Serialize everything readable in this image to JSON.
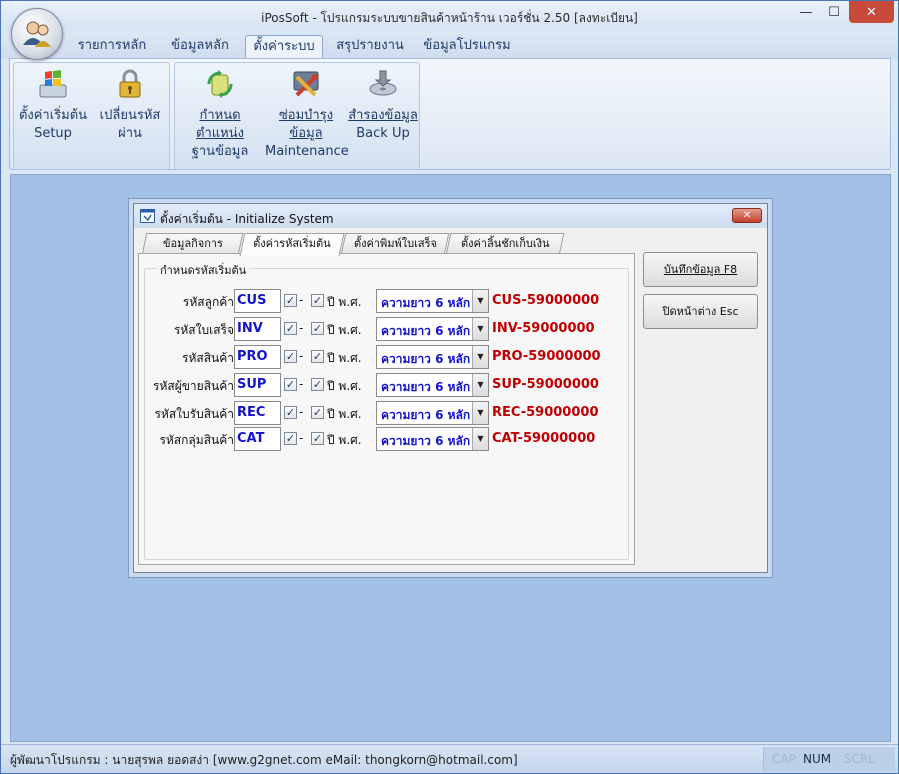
{
  "window": {
    "title": "iPosSoft - โปรแกรมระบบขายสินค้าหน้าร้าน เวอร์ชั่น 2.50 [ลงทะเบียน]",
    "min_glyph": "—",
    "max_glyph": "☐",
    "close_glyph": "✕"
  },
  "ribbon": {
    "tabs": [
      {
        "label": "รายการหลัก"
      },
      {
        "label": "ข้อมูลหลัก"
      },
      {
        "label": "ตั้งค่าระบบ"
      },
      {
        "label": "สรุปรายงาน"
      },
      {
        "label": "ข้อมูลโปรแกรม"
      }
    ],
    "active_tab": "ตั้งค่าระบบ",
    "buttons": [
      {
        "line1": "ตั้งค่าเริ่มต้น",
        "line2": "Setup",
        "icon": "windows-setup-icon"
      },
      {
        "line1": "เปลี่ยนรหัสผ่าน",
        "line2": "",
        "icon": "padlock-icon"
      },
      {
        "line1": "กำหนดตำแหน่ง",
        "line2": "ฐานข้อมูล",
        "icon": "database-location-icon"
      },
      {
        "line1": "ซ่อมบำรุงข้อมูล",
        "line2": "Maintenance",
        "icon": "tools-icon"
      },
      {
        "line1": "สำรองข้อมูล",
        "line2": "Back Up",
        "icon": "backup-disk-icon"
      }
    ]
  },
  "dialog": {
    "title": "ตั้งค่าเริ่มต้น - Initialize System",
    "close_glyph": "✕",
    "tabs": [
      {
        "label": "ข้อมูลกิจการ"
      },
      {
        "label": "ตั้งค่ารหัสเริ่มต้น"
      },
      {
        "label": "ตั้งค่าพิมพ์ใบเสร็จ"
      },
      {
        "label": "ตั้งค่าลิ้นชักเก็บเงิน"
      }
    ],
    "active_tab": "ตั้งค่ารหัสเริ่มต้น",
    "group_title": "กำหนดรหัสเริ่มต้น",
    "dash": "-",
    "check_glyph": "✓",
    "combo_arrow": "▼",
    "rows": [
      {
        "label": "รหัสลูกค้า",
        "code": "CUS",
        "use_dash": true,
        "use_year": true,
        "year_label": "ปี พ.ศ.",
        "length": "ความยาว 6 หลัก",
        "sample": "CUS-59000000"
      },
      {
        "label": "รหัสใบเสร็จ",
        "code": "INV",
        "use_dash": true,
        "use_year": true,
        "year_label": "ปี พ.ศ.",
        "length": "ความยาว 6 หลัก",
        "sample": "INV-59000000"
      },
      {
        "label": "รหัสสินค้า",
        "code": "PRO",
        "use_dash": true,
        "use_year": true,
        "year_label": "ปี พ.ศ.",
        "length": "ความยาว 6 หลัก",
        "sample": "PRO-59000000"
      },
      {
        "label": "รหัสผู้ขายสินค้า",
        "code": "SUP",
        "use_dash": true,
        "use_year": true,
        "year_label": "ปี พ.ศ.",
        "length": "ความยาว 6 หลัก",
        "sample": "SUP-59000000"
      },
      {
        "label": "รหัสใบรับสินค้า",
        "code": "REC",
        "use_dash": true,
        "use_year": true,
        "year_label": "ปี พ.ศ.",
        "length": "ความยาว 6 หลัก",
        "sample": "REC-59000000"
      },
      {
        "label": "รหัสกลุ่มสินค้า",
        "code": "CAT",
        "use_dash": true,
        "use_year": true,
        "year_label": "ปี พ.ศ.",
        "length": "ความยาว 6 หลัก",
        "sample": "CAT-59000000"
      }
    ],
    "save_button": "บันทึกข้อมูล F8",
    "close_button": "ปิดหน้าต่าง Esc"
  },
  "statusbar": {
    "text": "ผู้พัฒนาโปรแกรม : นายสุรพล ยอดสง่า [www.g2gnet.com  eMail: thongkorn@hotmail.com]",
    "cap": "CAP",
    "num": "NUM",
    "scrl": "SCRL"
  },
  "colors": {
    "accent": "#1414c8",
    "sample_red": "#c00000",
    "client_bg": "#a3c0e6",
    "close_red": "#c74a3a"
  }
}
